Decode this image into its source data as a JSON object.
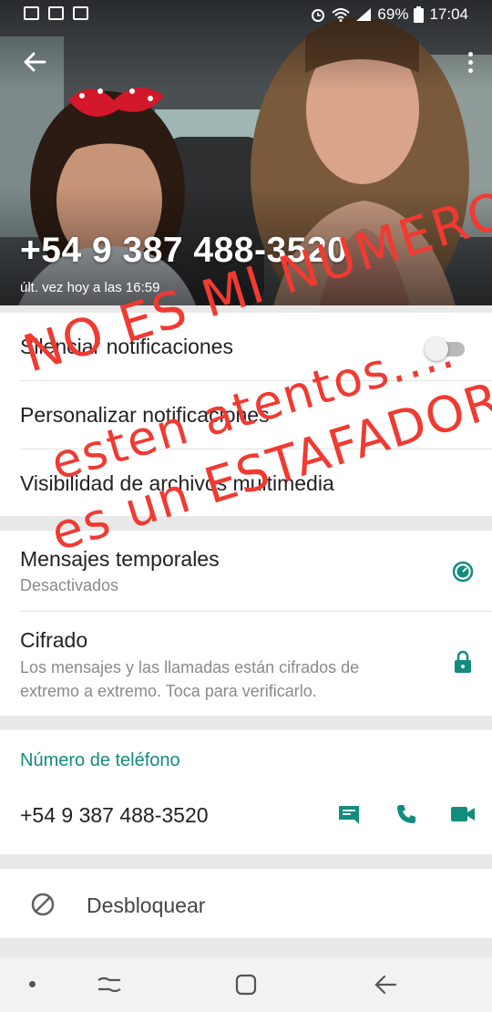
{
  "status_bar": {
    "battery": "69%",
    "time": "17:04"
  },
  "header": {
    "contact_name": "+54 9 387 488-3520",
    "last_seen": "últ. vez hoy a las 16:59"
  },
  "settings": [
    {
      "title": "Silenciar notificaciones",
      "toggle": "off"
    },
    {
      "title": "Personalizar notificaciones"
    },
    {
      "title": "Visibilidad de archivos multimedia"
    }
  ],
  "security": {
    "temporales_title": "Mensajes temporales",
    "temporales_sub": "Desactivados",
    "cifrado_title": "Cifrado",
    "cifrado_sub": "Los mensajes y las llamadas están cifrados de extremo a extremo. Toca para verificarlo."
  },
  "phone_section": {
    "title": "Número de teléfono",
    "number": "+54 9 387 488-3520"
  },
  "block": {
    "label": "Desbloquear"
  },
  "overlay_text": {
    "line1": "NO ES MI NUMERO!!",
    "line2": "esten atentos....",
    "line3": "es un ESTAFADOR"
  },
  "colors": {
    "accent": "#128c7e",
    "icon_green": "#128c7e",
    "scribble_red": "#f03a32"
  },
  "icons": [
    "back-arrow",
    "more-vert",
    "timer",
    "lock",
    "message",
    "phone",
    "videocam",
    "block"
  ]
}
